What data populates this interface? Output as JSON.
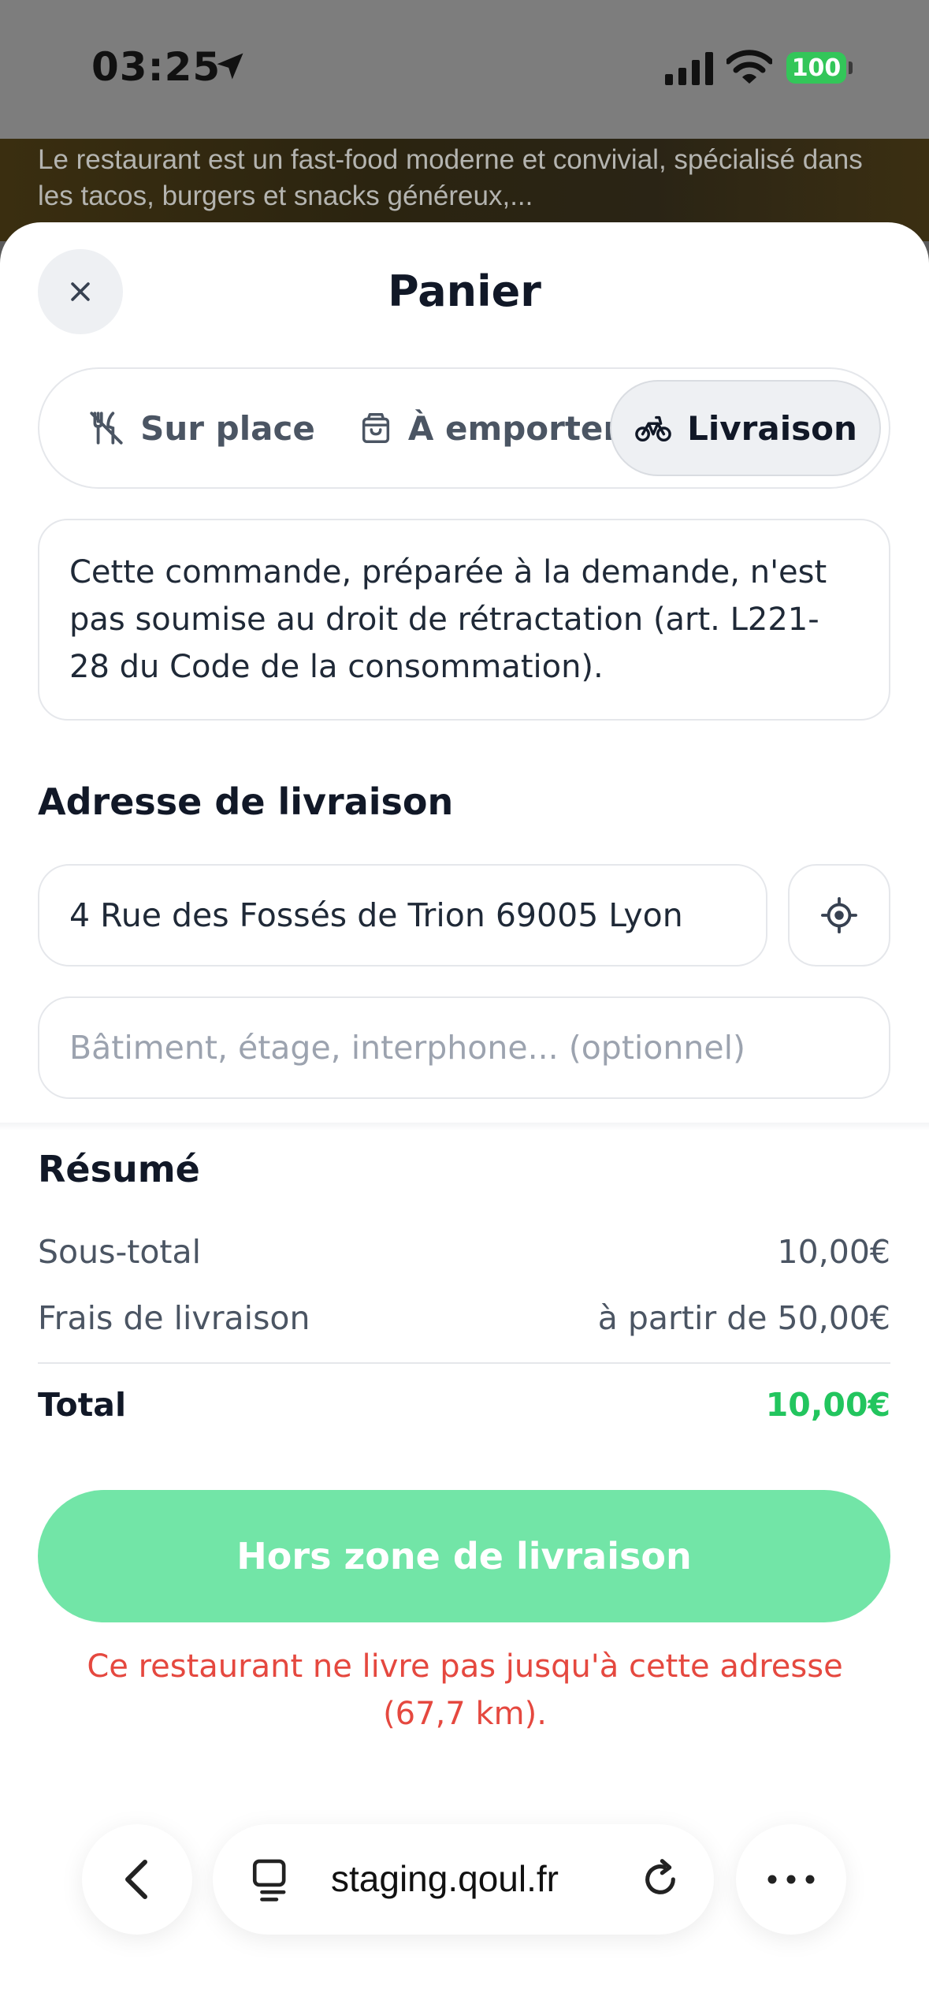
{
  "status_bar": {
    "time": "03:25",
    "battery": "100",
    "icons": [
      "location-arrow-icon",
      "signal-icon",
      "wifi-icon",
      "battery-icon"
    ]
  },
  "background": {
    "description": "Le restaurant est un fast-food moderne et convivial, spécialisé dans les tacos, burgers et snacks généreux,..."
  },
  "sheet": {
    "title": "Panier",
    "close_icon": "close-icon"
  },
  "order_modes": {
    "items": [
      {
        "label": "Sur place",
        "icon": "no-cutlery-icon",
        "selected": false
      },
      {
        "label": "À emporter",
        "icon": "shopping-bag-icon",
        "selected": false
      },
      {
        "label": "Livraison",
        "icon": "bicycle-icon",
        "selected": true
      }
    ]
  },
  "notice": {
    "text": "Cette commande, préparée à la demande, n'est pas soumise au droit de rétractation (art. L221-28 du Code de la consommation)."
  },
  "delivery": {
    "title": "Adresse de livraison",
    "address_value": "4 Rue des Fossés de Trion 69005 Lyon",
    "locate_icon": "crosshair-icon",
    "complement_placeholder": "Bâtiment, étage, interphone... (optionnel)"
  },
  "summary": {
    "title": "Résumé",
    "subtotal_label": "Sous-total",
    "subtotal_value": "10,00€",
    "delivery_fee_label": "Frais de livraison",
    "delivery_fee_value": "à partir de 50,00€",
    "total_label": "Total",
    "total_value": "10,00€"
  },
  "cta": {
    "label": "Hors zone de livraison",
    "error": "Ce restaurant ne livre pas jusqu'à cette adresse (67,7 km)."
  },
  "browser": {
    "url": "staging.qoul.fr",
    "icons": [
      "back-chevron-icon",
      "tabs-icon",
      "reload-icon",
      "more-icon"
    ]
  },
  "colors": {
    "accent_green": "#22c55e",
    "cta_disabled_green": "#72e5a7",
    "error_red": "#e5483f"
  }
}
